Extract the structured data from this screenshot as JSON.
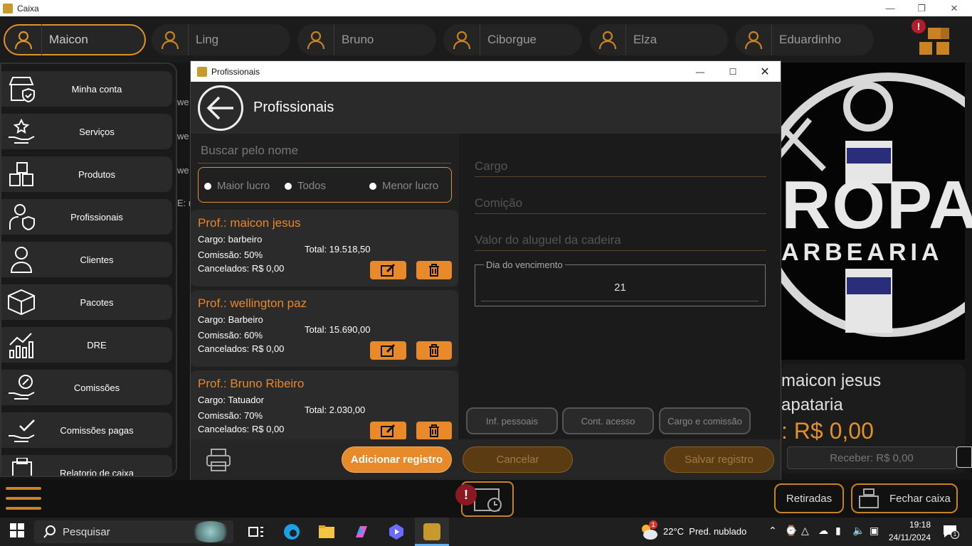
{
  "window": {
    "title": "Caixa"
  },
  "users": [
    {
      "name": "Maicon",
      "active": true
    },
    {
      "name": "Ling",
      "active": false
    },
    {
      "name": "Bruno",
      "active": false
    },
    {
      "name": "Ciborgue",
      "active": false
    },
    {
      "name": "Elza",
      "active": false
    },
    {
      "name": "Eduardinho",
      "active": false
    }
  ],
  "sidebar": {
    "items": [
      {
        "label": "Minha conta",
        "icon": "store-shield-icon"
      },
      {
        "label": "Serviços",
        "icon": "hand-star-icon"
      },
      {
        "label": "Produtos",
        "icon": "boxes-icon"
      },
      {
        "label": "Profissionais",
        "icon": "person-shield-icon"
      },
      {
        "label": "Clientes",
        "icon": "person-icon"
      },
      {
        "label": "Pacotes",
        "icon": "package-icon"
      },
      {
        "label": "DRE",
        "icon": "chart-icon"
      },
      {
        "label": "Comissões",
        "icon": "hand-percent-icon"
      },
      {
        "label": "Comissões pagas",
        "icon": "hand-check-icon"
      },
      {
        "label": "Relatorio de caixa",
        "icon": "register-icon"
      }
    ]
  },
  "behind": {
    "snippets": [
      "we",
      "we",
      "we",
      "E: n"
    ],
    "logo_text": "ROPA",
    "logo_sub": "ARBEARIA",
    "info_name": "maicon jesus",
    "info_place": "apataria",
    "info_value": ": R$ 0,00",
    "info_receive": "Receber: R$ 0,00",
    "btn_withdraw": "Retiradas",
    "btn_close": "Fechar caixa"
  },
  "dialog": {
    "title": "Profissionais",
    "header": "Profissionais",
    "search_placeholder": "Buscar pelo nome",
    "filters": [
      "Maior lucro",
      "Todos",
      "Menor lucro"
    ],
    "professionals": [
      {
        "name": "Prof.: maicon jesus",
        "cargo": "Cargo: barbeiro",
        "comissao": "Comissão: 50%",
        "cancelados": "Cancelados: R$ 0,00",
        "total": "Total: 19.518,50"
      },
      {
        "name": "Prof.: wellington paz",
        "cargo": "Cargo: Barbeiro",
        "comissao": "Comissão: 60%",
        "cancelados": "Cancelados: R$ 0,00",
        "total": "Total: 15.690,00"
      },
      {
        "name": "Prof.: Bruno Ribeiro",
        "cargo": "Cargo: Tatuador",
        "comissao": "Comissão: 70%",
        "cancelados": "Cancelados: R$ 0,00",
        "total": "Total: 2.030,00"
      }
    ],
    "form": {
      "cargo_placeholder": "Cargo",
      "comissao_placeholder": "Comição",
      "aluguel_placeholder": "Valor do aluguel da cadeira",
      "vencimento_label": "Dia do vencimento",
      "vencimento_value": "21"
    },
    "tabs": [
      "Inf. pessoais",
      "Cont. acesso",
      "Cargo e comissão"
    ],
    "add_label": "Adicionar registro",
    "cancel_label": "Cancelar",
    "save_label": "Salvar registro"
  },
  "taskbar": {
    "search": "Pesquisar",
    "weather": "22°C  Pred. nublado",
    "weather_badge": "1",
    "time": "19:18",
    "date": "24/11/2024",
    "notif": "1"
  },
  "colors": {
    "accent": "#e8892a",
    "bg": "#151515",
    "card": "#2b2b2b"
  }
}
